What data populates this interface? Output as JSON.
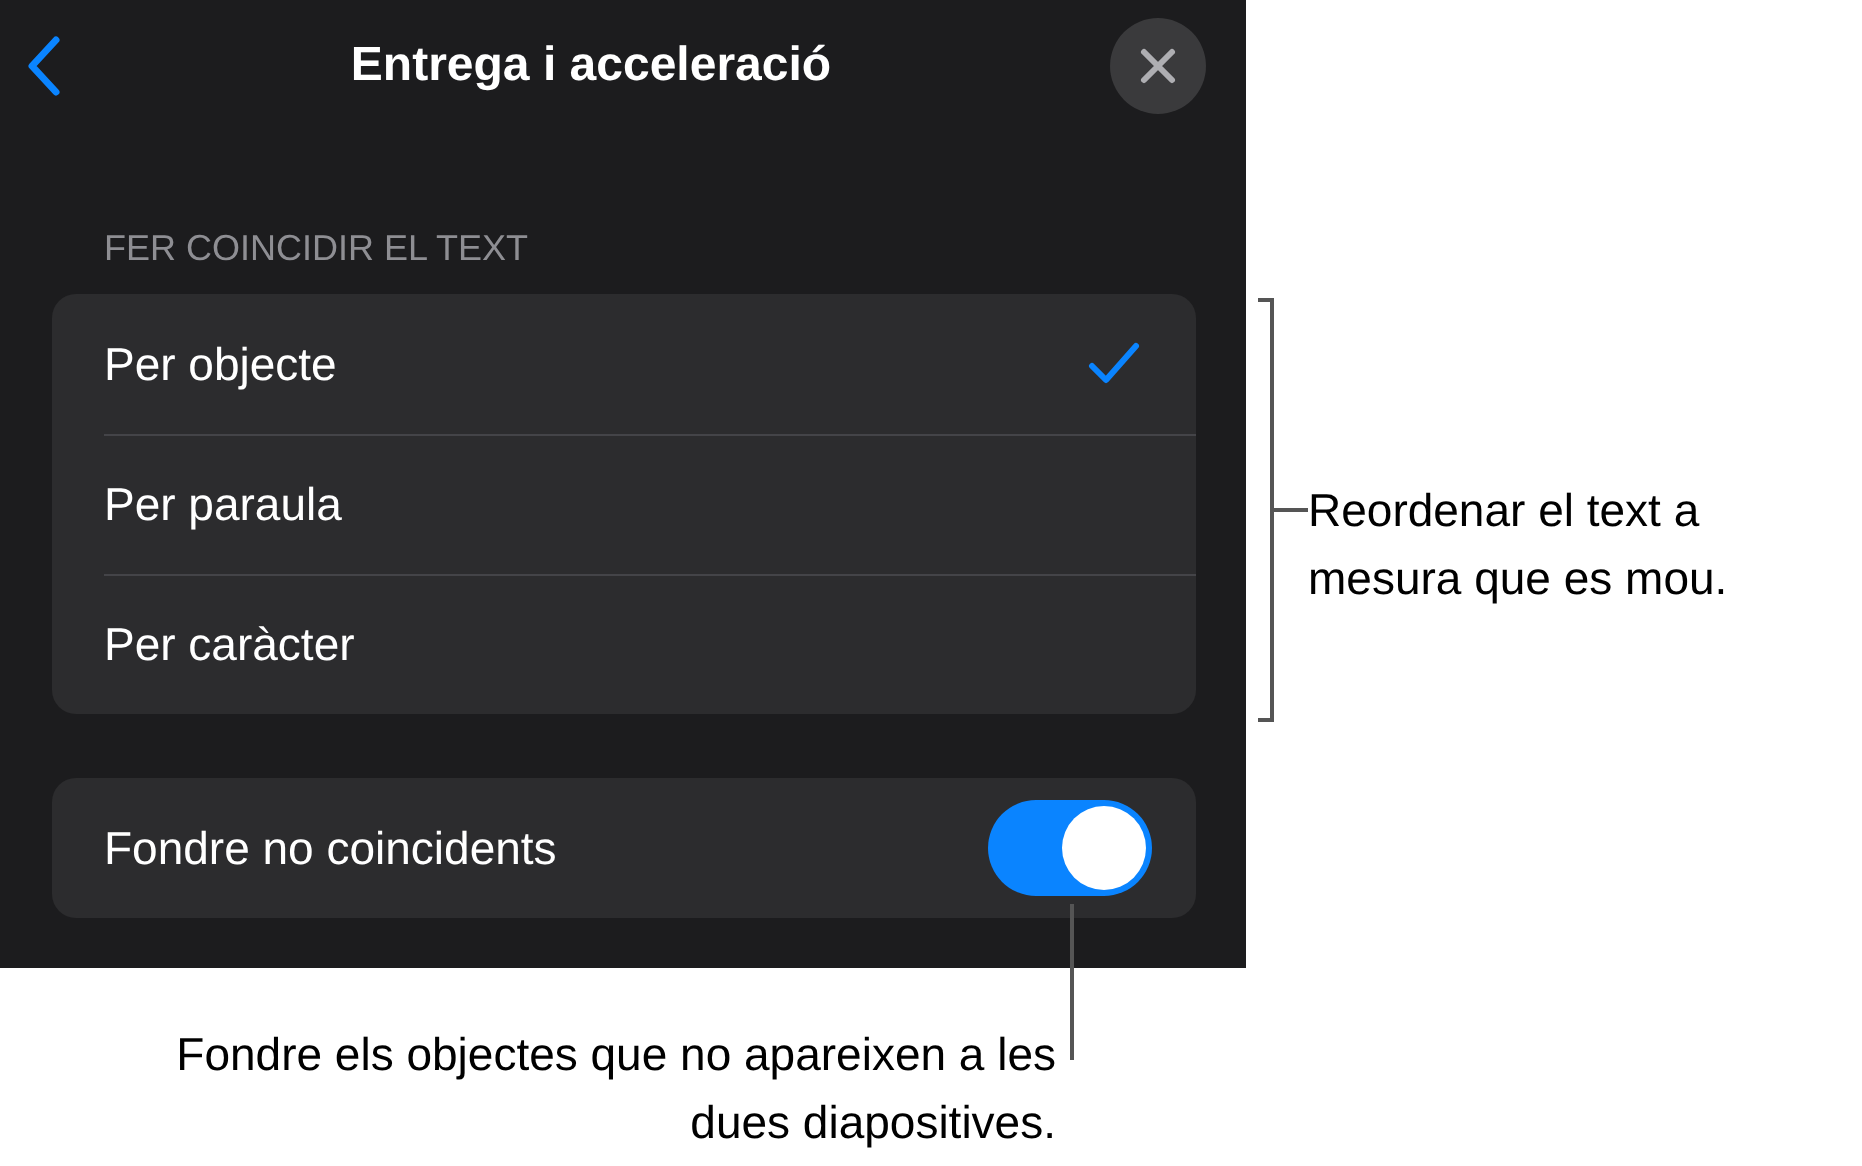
{
  "header": {
    "title": "Entrega i acceleració"
  },
  "section_label": "FER COINCIDIR EL TEXT",
  "options": [
    {
      "label": "Per objecte",
      "selected": true
    },
    {
      "label": "Per paraula",
      "selected": false
    },
    {
      "label": "Per caràcter",
      "selected": false
    }
  ],
  "toggle": {
    "label": "Fondre no coincidents",
    "on": true
  },
  "callouts": [
    {
      "text": "Reordenar el text a mesura que es mou."
    },
    {
      "text": "Fondre els objectes que no apareixen a les dues diapositives."
    }
  ]
}
